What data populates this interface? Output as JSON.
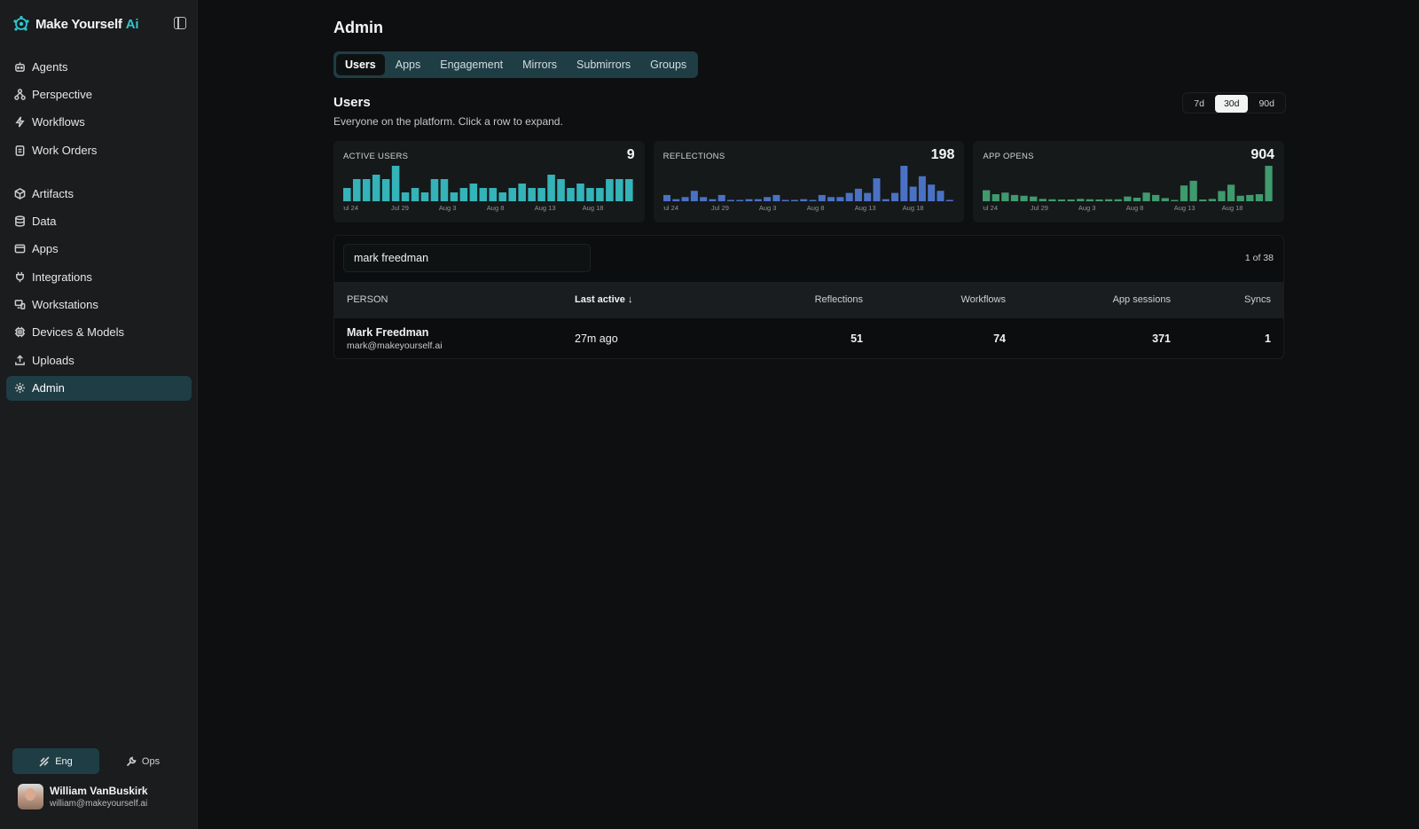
{
  "brand": {
    "name": "Make Yourself",
    "accent": "Ai",
    "accent_color": "#2fc6cf"
  },
  "sidebar": {
    "group1": [
      {
        "label": "Agents",
        "icon": "robot-icon"
      },
      {
        "label": "Perspective",
        "icon": "network-icon"
      },
      {
        "label": "Workflows",
        "icon": "lightning-icon"
      },
      {
        "label": "Work Orders",
        "icon": "clipboard-icon"
      }
    ],
    "group2": [
      {
        "label": "Artifacts",
        "icon": "cube-icon"
      },
      {
        "label": "Data",
        "icon": "database-icon"
      },
      {
        "label": "Apps",
        "icon": "window-icon"
      },
      {
        "label": "Integrations",
        "icon": "plug-icon"
      },
      {
        "label": "Workstations",
        "icon": "monitor-icon"
      },
      {
        "label": "Devices & Models",
        "icon": "chip-icon"
      },
      {
        "label": "Uploads",
        "icon": "upload-icon"
      },
      {
        "label": "Admin",
        "icon": "gear-icon",
        "active": true
      }
    ],
    "modes": [
      {
        "label": "Eng",
        "icon": "ruler-pencil-icon",
        "active": true
      },
      {
        "label": "Ops",
        "icon": "wrench-icon",
        "active": false
      }
    ],
    "user": {
      "name": "William VanBuskirk",
      "email": "william@makeyourself.ai"
    }
  },
  "page": {
    "title": "Admin",
    "tabs": [
      "Users",
      "Apps",
      "Engagement",
      "Mirrors",
      "Submirrors",
      "Groups"
    ],
    "active_tab": "Users",
    "section_title": "Users",
    "section_subtitle": "Everyone on the platform. Click a row to expand.",
    "ranges": [
      "7d",
      "30d",
      "90d"
    ],
    "active_range": "30d"
  },
  "chart_data": [
    {
      "type": "bar",
      "title": "ACTIVE USERS",
      "total": "9",
      "color": "#34b3b8",
      "tick_labels": [
        "Jul 24",
        "Jul 29",
        "Aug 3",
        "Aug 8",
        "Aug 13",
        "Aug 18"
      ],
      "values": [
        3,
        5,
        5,
        6,
        5,
        8,
        2,
        3,
        2,
        5,
        5,
        2,
        3,
        4,
        3,
        3,
        2,
        3,
        4,
        3,
        3,
        6,
        5,
        3,
        4,
        3,
        3,
        5,
        5,
        5
      ]
    },
    {
      "type": "bar",
      "title": "REFLECTIONS",
      "total": "198",
      "color": "#4a72c4",
      "tick_labels": [
        "Jul 24",
        "Jul 29",
        "Aug 3",
        "Aug 8",
        "Aug 13",
        "Aug 18"
      ],
      "values": [
        3,
        1,
        2,
        5,
        2,
        1,
        3,
        0,
        0,
        1,
        1,
        2,
        3,
        0,
        0,
        1,
        0,
        3,
        2,
        2,
        4,
        6,
        4,
        11,
        1,
        4,
        17,
        7,
        12,
        8,
        5,
        0
      ]
    },
    {
      "type": "bar",
      "title": "APP OPENS",
      "total": "904",
      "color": "#3f9a6e",
      "tick_labels": [
        "Jul 24",
        "Jul 29",
        "Aug 3",
        "Aug 8",
        "Aug 13",
        "Aug 18"
      ],
      "values": [
        28,
        18,
        22,
        16,
        14,
        12,
        6,
        5,
        3,
        2,
        6,
        5,
        4,
        5,
        5,
        12,
        9,
        22,
        16,
        8,
        0,
        40,
        52,
        2,
        6,
        26,
        42,
        14,
        16,
        18,
        90
      ]
    }
  ],
  "table": {
    "search_value": "mark freedman",
    "count": "1 of 38",
    "columns": [
      "PERSON",
      "Last active",
      "Reflections",
      "Workflows",
      "App sessions",
      "Syncs"
    ],
    "sort_icon": "arrow-down-icon",
    "rows": [
      {
        "name": "Mark Freedman",
        "email": "mark@makeyourself.ai",
        "last_active": "27m ago",
        "reflections": "51",
        "workflows": "74",
        "app_sessions": "371",
        "syncs": "1"
      }
    ]
  }
}
